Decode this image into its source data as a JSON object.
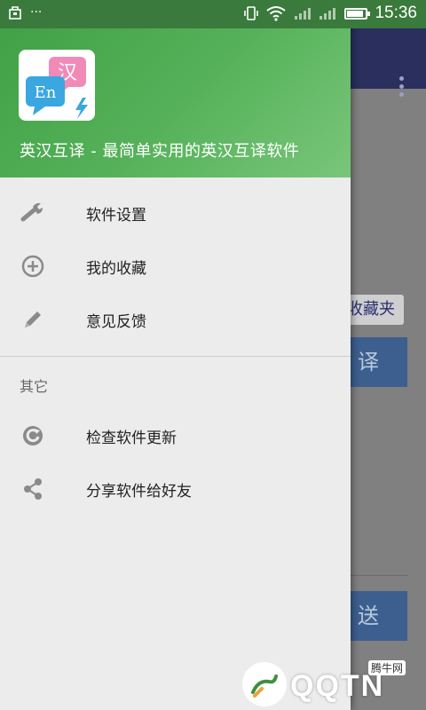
{
  "status_bar": {
    "time": "15:36",
    "dots": "···"
  },
  "drawer": {
    "header_title": "英汉互译 - 最简单实用的英汉互译软件",
    "logo": {
      "text_en": "En",
      "text_cn": "汉"
    },
    "items": [
      {
        "label": "软件设置",
        "icon": "wrench-icon"
      },
      {
        "label": "我的收藏",
        "icon": "add-circle-icon"
      },
      {
        "label": "意见反馈",
        "icon": "pencil-icon"
      }
    ],
    "section_label": "其它",
    "other_items": [
      {
        "label": "检查软件更新",
        "icon": "refresh-icon"
      },
      {
        "label": "分享软件给好友",
        "icon": "share-icon"
      }
    ]
  },
  "background": {
    "chip_label": "收藏夹",
    "button1_label": "译",
    "button2_label": "送"
  },
  "watermark": {
    "text": "QQTN",
    "small": "腾牛网"
  }
}
